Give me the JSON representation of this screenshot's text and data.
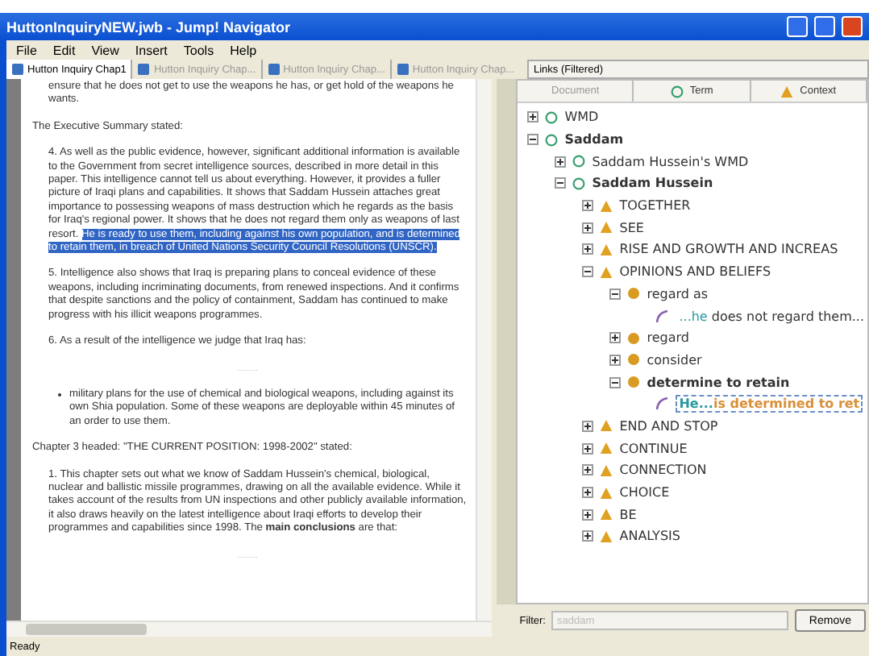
{
  "window": {
    "title": "HuttonInquiryNEW.jwb - Jump! Navigator"
  },
  "menu": [
    "File",
    "Edit",
    "View",
    "Insert",
    "Tools",
    "Help"
  ],
  "doc_tabs": [
    {
      "label": "Hutton Inquiry Chap1",
      "selected": true
    },
    {
      "label": "Hutton Inquiry Chap...",
      "selected": false
    },
    {
      "label": "Hutton Inquiry Chap...",
      "selected": false
    },
    {
      "label": "Hutton Inquiry Chap...",
      "selected": false
    }
  ],
  "document": [
    {
      "kind": "para",
      "text": "ensure that he does not get to use the weapons he has, or get hold of the weapons he wants."
    },
    {
      "kind": "heading",
      "text": "The Executive Summary stated:"
    },
    {
      "kind": "para",
      "text": "4. As well as the public evidence, however, significant additional information is available to the Government from secret intelligence sources, described in more detail in this paper. This intelligence cannot tell us about everything. However, it provides a fuller picture of Iraqi plans and capabilities. It shows that Saddam Hussein attaches great importance to possessing weapons of mass destruction which he regards as the basis for Iraq's regional power. It shows that he does not regard them only as weapons of last resort.",
      "highlight": "He is ready to use them, including against his own population, and is determined to retain them, in breach of United Nations Security Council Resolutions (UNSCR)."
    },
    {
      "kind": "para",
      "text": "5. Intelligence also shows that Iraq is preparing plans to conceal evidence of these weapons, including incriminating documents, from renewed inspections. And it confirms that despite sanctions and the policy of containment, Saddam has continued to make progress with his illicit weapons programmes."
    },
    {
      "kind": "para",
      "text": "6. As a result of the intelligence we judge that Iraq has:"
    },
    {
      "kind": "ellipsis",
      "text": "........."
    },
    {
      "kind": "bullet",
      "text": "military plans for the use of chemical and biological weapons, including against its own Shia population. Some of these weapons are deployable within 45 minutes of an order to use them."
    },
    {
      "kind": "heading",
      "text": "Chapter 3 headed: \"THE CURRENT POSITION: 1998-2002\" stated:"
    },
    {
      "kind": "para",
      "text": "1. This chapter sets out what we know of Saddam Hussein's chemical, biological, nuclear and ballistic missile programmes, drawing on all the available evidence. While it takes account of the results from UN inspections and other publicly available information, it also draws heavily on the latest intelligence about Iraqi efforts to develop their programmes and capabilities since 1998. The **main conclusions** are that:"
    },
    {
      "kind": "ellipsis",
      "text": "........."
    }
  ],
  "links_panel": {
    "title": "Links (Filtered)",
    "columns": [
      "Document",
      "Term",
      "Context"
    ],
    "tree": [
      {
        "kind": "term",
        "label": "WMD",
        "expanded": false,
        "bold": false
      },
      {
        "kind": "term",
        "label": "Saddam",
        "expanded": true,
        "bold": true,
        "children": [
          {
            "kind": "term",
            "label": "Saddam Hussein's WMD",
            "expanded": false,
            "bold": false
          },
          {
            "kind": "term",
            "label": "Saddam Hussein",
            "expanded": true,
            "bold": true,
            "children": [
              {
                "kind": "category",
                "label": "TOGETHER",
                "expanded": false,
                "bold": false
              },
              {
                "kind": "category",
                "label": "SEE",
                "expanded": false,
                "bold": false
              },
              {
                "kind": "category",
                "label": "RISE AND GROWTH AND INCREAS",
                "expanded": false,
                "bold": false
              },
              {
                "kind": "category",
                "label": "OPINIONS AND BELIEFS",
                "expanded": true,
                "bold": false,
                "children": [
                  {
                    "kind": "word",
                    "label": "regard as",
                    "expanded": true,
                    "bold": false,
                    "children": [
                      {
                        "kind": "context",
                        "match": "...he",
                        "rest": " does not regard them...",
                        "selected": false
                      }
                    ]
                  },
                  {
                    "kind": "word",
                    "label": "regard",
                    "expanded": false,
                    "bold": false
                  },
                  {
                    "kind": "word",
                    "label": "consider",
                    "expanded": false,
                    "bold": false
                  },
                  {
                    "kind": "word",
                    "label": "determine to retain",
                    "expanded": true,
                    "bold": true,
                    "children": [
                      {
                        "kind": "context",
                        "match": "He...",
                        "rest": "is determined to ret",
                        "selected": true
                      }
                    ]
                  }
                ]
              },
              {
                "kind": "category",
                "label": "END AND STOP",
                "expanded": false,
                "bold": false
              },
              {
                "kind": "category",
                "label": "CONTINUE",
                "expanded": false,
                "bold": false
              },
              {
                "kind": "category",
                "label": "CONNECTION",
                "expanded": false,
                "bold": false
              },
              {
                "kind": "category",
                "label": "CHOICE",
                "expanded": false,
                "bold": false
              },
              {
                "kind": "category",
                "label": "BE",
                "expanded": false,
                "bold": false
              },
              {
                "kind": "category",
                "label": "ANALYSIS",
                "expanded": false,
                "bold": false
              }
            ]
          }
        ]
      }
    ],
    "filter": {
      "label": "Filter:",
      "placeholder": "saddam"
    },
    "remove_button": "Remove"
  },
  "status_bar": "Ready"
}
